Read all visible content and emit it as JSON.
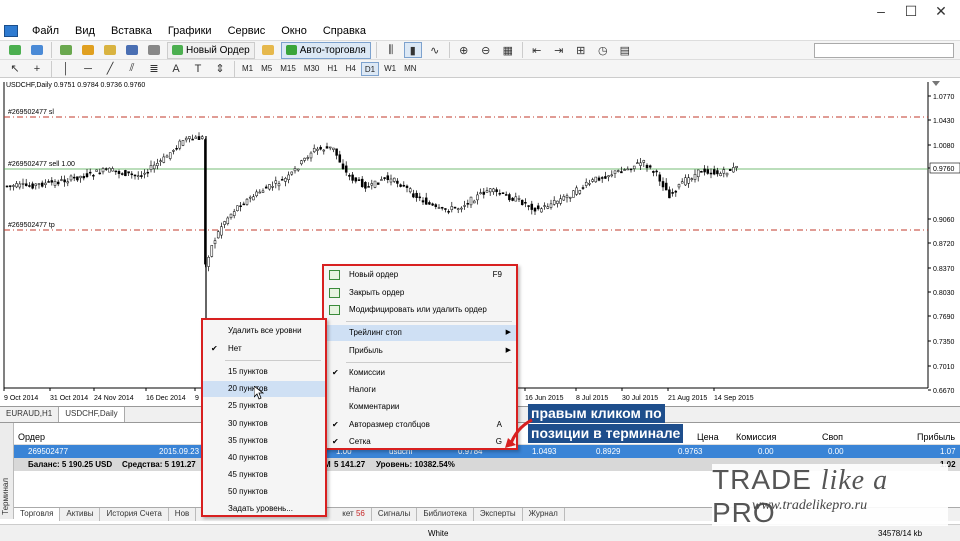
{
  "window": {
    "title": "",
    "controls": [
      "–",
      "☐",
      "✕"
    ]
  },
  "menu": [
    "Файл",
    "Вид",
    "Вставка",
    "Графики",
    "Сервис",
    "Окно",
    "Справка"
  ],
  "toolbar": {
    "new_order": "Новый Ордер",
    "auto_trading": "Авто-торговля",
    "search_placeholder": ""
  },
  "timeframes": [
    "M1",
    "M5",
    "M15",
    "M30",
    "H1",
    "H4",
    "D1",
    "W1",
    "MN"
  ],
  "active_timeframe": "D1",
  "chart": {
    "title": "USDCHF,Daily  0.9751 0.9784 0.9736 0.9760",
    "sl_label": "#269502477 sl",
    "order_label": "#269502477 sell 1.00",
    "tp_label": "#269502477 tp",
    "price_ticks": [
      "1.0770",
      "1.0430",
      "1.0080",
      "0.9760",
      "0.9060",
      "0.8720",
      "0.8370",
      "0.8030",
      "0.7690",
      "0.7350",
      "0.7010",
      "0.6670"
    ],
    "current_price": "0.9760",
    "date_ticks": [
      "9 Oct 2014",
      "31 Oct 2014",
      "24 Nov 2014",
      "16 Dec 2014",
      "9",
      "16 Jun 2015",
      "8 Jul 2015",
      "30 Jul 2015",
      "21 Aug 2015",
      "14 Sep 2015"
    ],
    "colors": {
      "bull": "#000000",
      "bear": "#000000",
      "sl_tp": "#c0392b",
      "order_line": "#4aa84a"
    }
  },
  "chart_tabs": [
    "EURAUD,H1",
    "USDCHF,Daily"
  ],
  "active_chart_tab": "USDCHF,Daily",
  "terminal": {
    "side_label": "Терминал",
    "columns": {
      "order": "Ордер",
      "price": "Цена",
      "commission": "Комиссия",
      "swap": "Своп",
      "profit": "Прибыль"
    },
    "order_row": {
      "id": "269502477",
      "time": "2015.09.23",
      "volume": "1.00",
      "symbol": "usdchf",
      "open_price": "0.9784",
      "sl": "1.0493",
      "tp": "0.8929",
      "price": "0.9763",
      "commission": "0.00",
      "swap": "0.00",
      "profit": "1.07"
    },
    "balance_row": {
      "balance": "Баланс: 5 190.25 USD",
      "equity": "Средства: 5 191.27",
      "margin_level": "М",
      "free_margin": "5 141.27",
      "level": "Уровень: 10382.54%",
      "profit": "1.02"
    },
    "tabs": [
      "Торговля",
      "Активы",
      "История Счета",
      "Нов",
      "кет",
      "Сигналы",
      "Библиотека",
      "Эксперты",
      "Журнал"
    ],
    "market_badge": "56"
  },
  "status_bar": {
    "profile": "White",
    "traffic": "34578/14 kb"
  },
  "main_menu": {
    "items": [
      {
        "label": "Новый ордер",
        "shortcut": "F9",
        "icon": "new-order-icon"
      },
      {
        "label": "Закрыть ордер",
        "shortcut": "",
        "icon": "close-order-icon"
      },
      {
        "label": "Модифицировать или удалить ордер",
        "shortcut": "",
        "icon": "modify-order-icon"
      },
      {
        "label": "Трейлинг стоп",
        "shortcut": "",
        "submenu": true
      },
      {
        "label": "Прибыль",
        "shortcut": "",
        "submenu": true
      },
      {
        "label": "Комиссии",
        "shortcut": "",
        "checked": true
      },
      {
        "label": "Налоги",
        "shortcut": ""
      },
      {
        "label": "Комментарии",
        "shortcut": ""
      },
      {
        "label": "Авторазмер столбцов",
        "shortcut": "A",
        "checked": true
      },
      {
        "label": "Сетка",
        "shortcut": "G",
        "checked": true
      }
    ]
  },
  "trailing_menu": {
    "items": [
      {
        "label": "Удалить все уровни"
      },
      {
        "label": "Нет",
        "checked": true
      },
      {
        "label": "15 пунктов"
      },
      {
        "label": "20 пунктов",
        "highlighted": true
      },
      {
        "label": "25 пунктов"
      },
      {
        "label": "30 пунктов"
      },
      {
        "label": "35 пунктов"
      },
      {
        "label": "40 пунктов"
      },
      {
        "label": "45 пунктов"
      },
      {
        "label": "50 пунктов"
      },
      {
        "label": "Задать уровень..."
      }
    ]
  },
  "annotation": [
    "правым кликом по",
    "позиции в терминале"
  ],
  "brand": {
    "trade": "TRADE ",
    "like_a": "like a ",
    "pro": "PRO",
    "url": "www.tradelikepro.ru"
  }
}
